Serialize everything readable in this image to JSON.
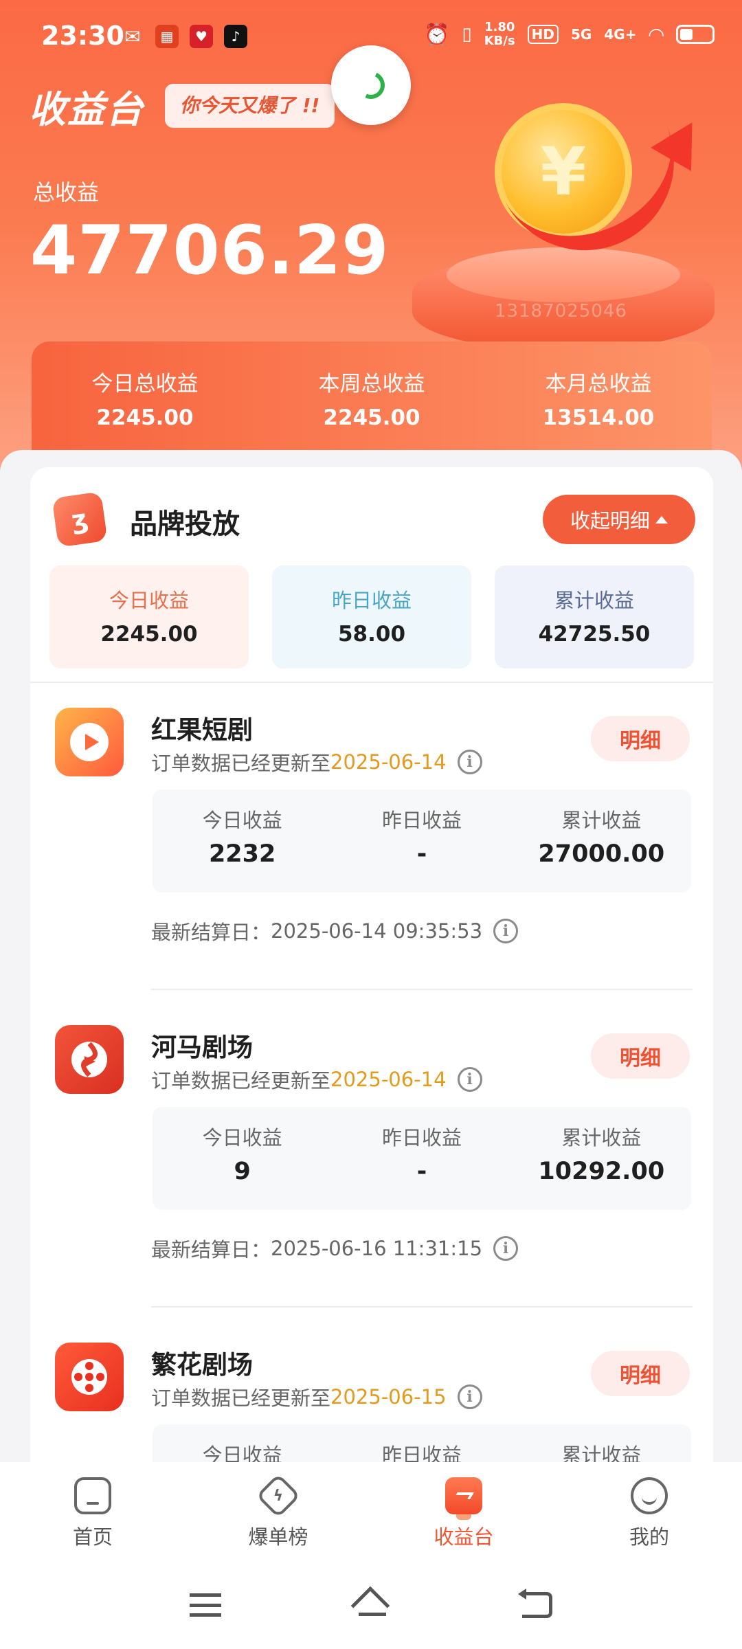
{
  "status_bar": {
    "time": "23:30",
    "net_speed_value": "1.80",
    "net_speed_unit": "KB/s",
    "hd_badge": "HD",
    "signal_1": "5G",
    "signal_2": "4G+"
  },
  "header": {
    "title": "收益台",
    "slogan": "你今天又爆了 !!",
    "watermark": "13187025046",
    "total_label": "总收益",
    "total_value": "47706.29",
    "periods": [
      {
        "label": "今日总收益",
        "value": "2245.00"
      },
      {
        "label": "本周总收益",
        "value": "2245.00"
      },
      {
        "label": "本月总收益",
        "value": "13514.00"
      }
    ]
  },
  "brand_section": {
    "title": "品牌投放",
    "collapse_label": "收起明细",
    "summary": [
      {
        "label": "今日收益",
        "value": "2245.00"
      },
      {
        "label": "昨日收益",
        "value": "58.00"
      },
      {
        "label": "累计收益",
        "value": "42725.50"
      }
    ]
  },
  "items": [
    {
      "name": "红果短剧",
      "update_prefix": "订单数据已经更新至",
      "update_date": "2025-06-14",
      "detail_label": "明细",
      "stats": [
        {
          "label": "今日收益",
          "value": "2232"
        },
        {
          "label": "昨日收益",
          "value": "-"
        },
        {
          "label": "累计收益",
          "value": "27000.00"
        }
      ],
      "settle_prefix": "最新结算日：",
      "settle_time": "2025-06-14 09:35:53"
    },
    {
      "name": "河马剧场",
      "update_prefix": "订单数据已经更新至",
      "update_date": "2025-06-14",
      "detail_label": "明细",
      "stats": [
        {
          "label": "今日收益",
          "value": "9"
        },
        {
          "label": "昨日收益",
          "value": "-"
        },
        {
          "label": "累计收益",
          "value": "10292.00"
        }
      ],
      "settle_prefix": "最新结算日：",
      "settle_time": "2025-06-16 11:31:15"
    },
    {
      "name": "繁花剧场",
      "update_prefix": "订单数据已经更新至",
      "update_date": "2025-06-15",
      "detail_label": "明细",
      "stats": [
        {
          "label": "今日收益",
          "value": ""
        },
        {
          "label": "昨日收益",
          "value": ""
        },
        {
          "label": "累计收益",
          "value": ""
        }
      ],
      "settle_prefix": "",
      "settle_time": ""
    }
  ],
  "tabbar": [
    {
      "label": "首页",
      "icon": "home-icon"
    },
    {
      "label": "爆单榜",
      "icon": "lightning-icon"
    },
    {
      "label": "收益台",
      "icon": "earnings-icon",
      "active": true
    },
    {
      "label": "我的",
      "icon": "profile-icon"
    }
  ],
  "colors": {
    "brand": "#f25d3c",
    "accent_date": "#e39a1d",
    "active_tab": "#f05532"
  }
}
